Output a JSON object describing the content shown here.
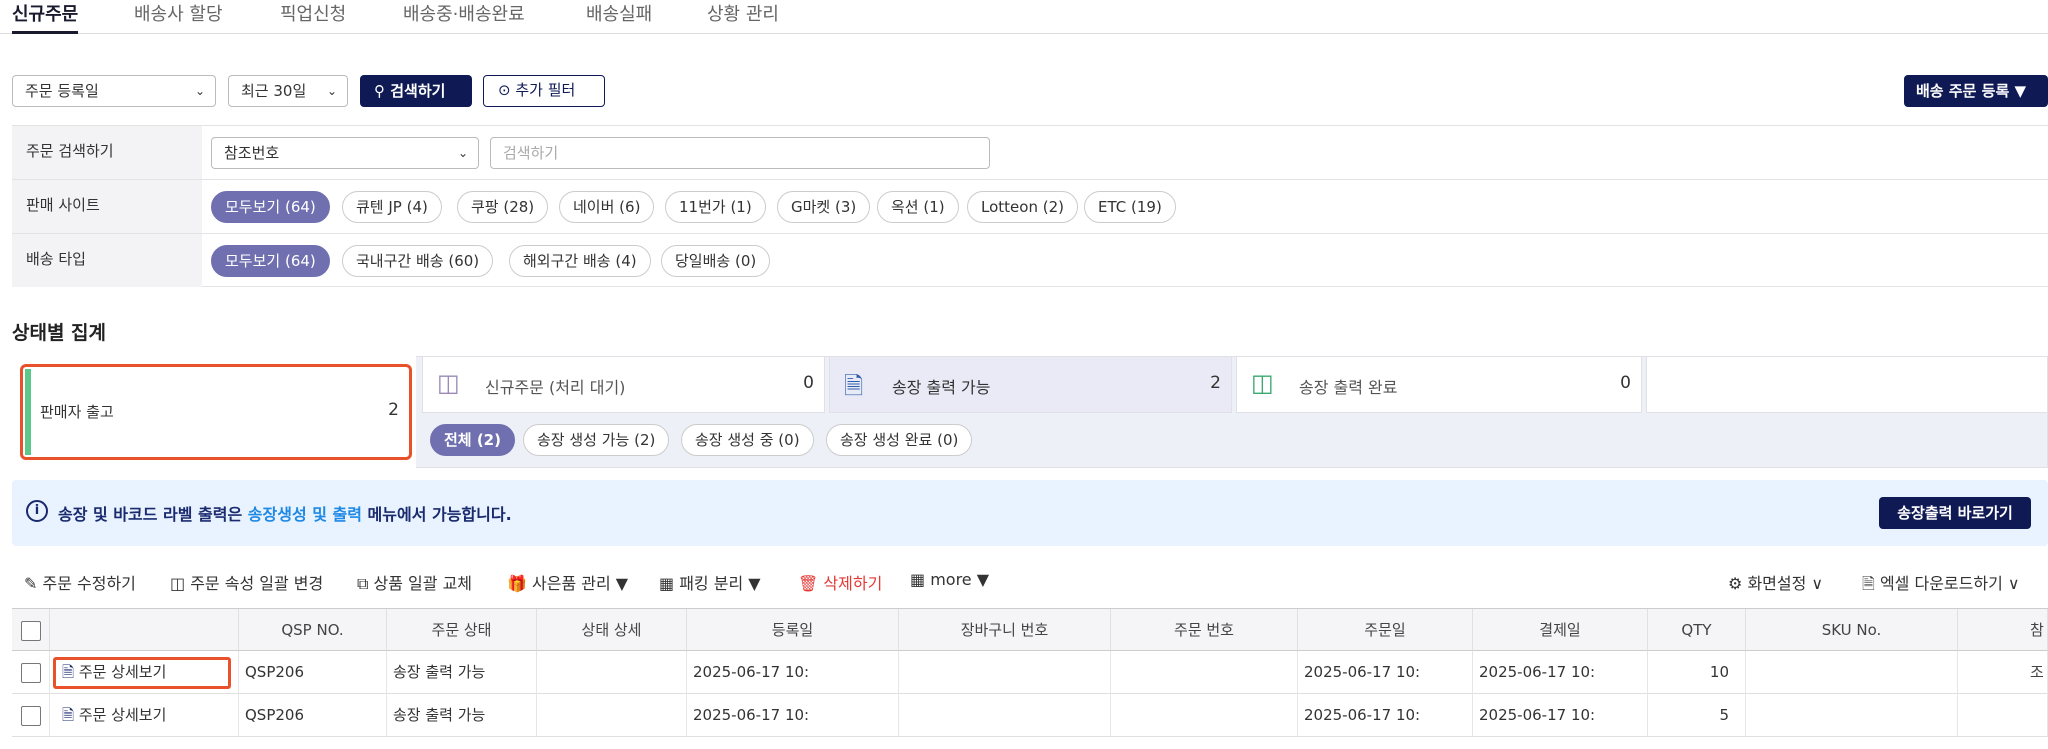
{
  "tabs": [
    "신규주문",
    "배송사 할당",
    "픽업신청",
    "배송중·배송완료",
    "배송실패",
    "상황 관리"
  ],
  "toolbar": {
    "date_type": "주문 등록일",
    "period": "최근 30일",
    "search_btn": "검색하기",
    "filter_btn": "추가 필터",
    "register_btn": "배송 주문 등록 ▼"
  },
  "filters": {
    "search_label": "주문 검색하기",
    "search_field": "참조번호",
    "search_placeholder": "검색하기",
    "site_label": "판매 사이트",
    "sites": [
      "모두보기 (64)",
      "큐텐 JP (4)",
      "쿠팡 (28)",
      "네이버 (6)",
      "11번가 (1)",
      "G마켓 (3)",
      "옥션 (1)",
      "Lotteon (2)",
      "ETC (19)"
    ],
    "ship_label": "배송 타입",
    "ship_types": [
      "모두보기 (64)",
      "국내구간 배송 (60)",
      "해외구간 배송 (4)",
      "당일배송 (0)"
    ]
  },
  "status": {
    "title": "상태별 집계",
    "seller_label": "판매자 출고",
    "seller_count": "2",
    "cards": [
      {
        "label": "신규주문 (처리 대기)",
        "count": "0"
      },
      {
        "label": "송장 출력 가능",
        "count": "2"
      },
      {
        "label": "송장 출력 완료",
        "count": "0"
      }
    ],
    "sub_pills": [
      "전체 (2)",
      "송장 생성 가능 (2)",
      "송장 생성 중 (0)",
      "송장 생성 완료 (0)"
    ]
  },
  "notice": {
    "prefix": "송장 및 바코드 라벨 출력은 ",
    "link": "송장생성 및 출력",
    "suffix": " 메뉴에서 가능합니다.",
    "button": "송장출력 바로가기"
  },
  "actions": {
    "edit": "주문 수정하기",
    "attr": "주문 속성 일괄 변경",
    "replace": "상품 일괄 교체",
    "gift": "사은품 관리 ▼",
    "pack": "패킹 분리 ▼",
    "delete": "삭제하기",
    "more": "more ▼",
    "settings": "화면설정 ∨",
    "excel": "엑셀 다운로드하기 ∨"
  },
  "table": {
    "headers": [
      "",
      "QSP NO.",
      "주문 상태",
      "상태 상세",
      "등록일",
      "장바구니 번호",
      "주문 번호",
      "주문일",
      "결제일",
      "QTY",
      "SKU No.",
      "참조"
    ],
    "rows": [
      {
        "detail": "주문 상세보기",
        "qsp": "QSP206",
        "status": "송장 출력 가능",
        "reg": "2025-06-17 10:",
        "order_date": "2025-06-17 10:",
        "pay_date": "2025-06-17 10:",
        "qty": "10"
      },
      {
        "detail": "주문 상세보기",
        "qsp": "QSP206",
        "status": "송장 출력 가능",
        "reg": "2025-06-17 10:",
        "order_date": "2025-06-17 10:",
        "pay_date": "2025-06-17 10:",
        "qty": "5"
      }
    ]
  },
  "colors": {
    "navy": "#0f1a55",
    "purple": "#7070b0",
    "highlight": "#e8512a",
    "green": "#5cc98a",
    "link": "#1e88e5",
    "danger": "#e53935"
  }
}
